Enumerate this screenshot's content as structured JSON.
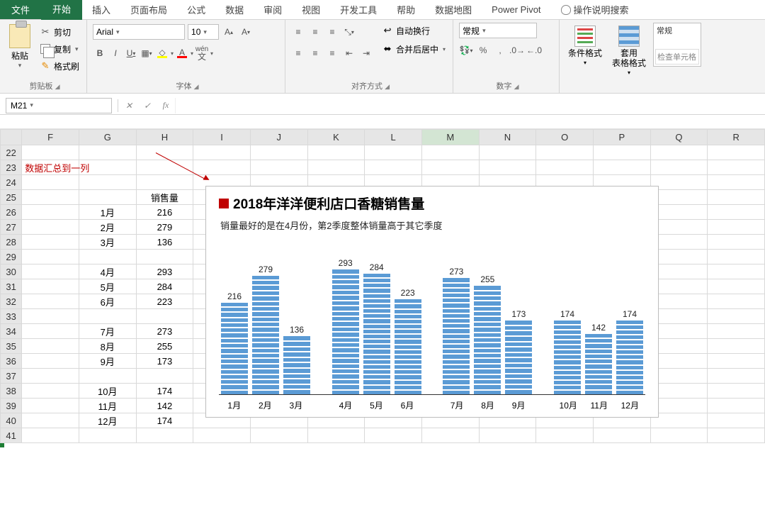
{
  "tabs": {
    "file": "文件",
    "start": "开始",
    "insert": "插入",
    "page": "页面布局",
    "formula": "公式",
    "data": "数据",
    "review": "审阅",
    "view": "视图",
    "dev": "开发工具",
    "help": "帮助",
    "map": "数据地图",
    "pivot": "Power Pivot",
    "tell": "操作说明搜索"
  },
  "ribbon": {
    "clipboard": {
      "paste": "粘贴",
      "cut": "剪切",
      "copy": "复制",
      "painter": "格式刷",
      "title": "剪贴板"
    },
    "font": {
      "name": "Arial",
      "size": "10",
      "title": "字体",
      "wen": "wén"
    },
    "align": {
      "wrap": "自动换行",
      "merge": "合并后居中",
      "title": "对齐方式"
    },
    "number": {
      "format": "常规",
      "title": "数字"
    },
    "styles": {
      "cond": "条件格式",
      "table": "套用\n表格格式"
    },
    "cell_styles": {
      "label": "常规",
      "check": "检查单元格"
    }
  },
  "namebox": "M21",
  "columns": [
    "F",
    "G",
    "H",
    "I",
    "J",
    "K",
    "L",
    "M",
    "N",
    "O",
    "P",
    "Q",
    "R"
  ],
  "active_col": "M",
  "row_start": 22,
  "row_end": 41,
  "annotation": "数据汇总到一列",
  "table": {
    "header_label": "销售量",
    "rows": [
      {
        "r": 25,
        "g": "",
        "h": "销售量"
      },
      {
        "r": 26,
        "g": "1月",
        "h": "216"
      },
      {
        "r": 27,
        "g": "2月",
        "h": "279"
      },
      {
        "r": 28,
        "g": "3月",
        "h": "136"
      },
      {
        "r": 29,
        "g": "",
        "h": ""
      },
      {
        "r": 30,
        "g": "4月",
        "h": "293"
      },
      {
        "r": 31,
        "g": "5月",
        "h": "284"
      },
      {
        "r": 32,
        "g": "6月",
        "h": "223"
      },
      {
        "r": 33,
        "g": "",
        "h": ""
      },
      {
        "r": 34,
        "g": "7月",
        "h": "273"
      },
      {
        "r": 35,
        "g": "8月",
        "h": "255"
      },
      {
        "r": 36,
        "g": "9月",
        "h": "173"
      },
      {
        "r": 37,
        "g": "",
        "h": ""
      },
      {
        "r": 38,
        "g": "10月",
        "h": "174"
      },
      {
        "r": 39,
        "g": "11月",
        "h": "142"
      },
      {
        "r": 40,
        "g": "12月",
        "h": "174"
      }
    ]
  },
  "chart_data": {
    "type": "bar",
    "title": "2018年洋洋便利店口香糖销售量",
    "subtitle": "销量最好的是在4月份，第2季度整体销量高于其它季度",
    "ylim": [
      0,
      300
    ],
    "series": [
      {
        "name": "销售量",
        "categories": [
          "1月",
          "2月",
          "3月",
          "4月",
          "5月",
          "6月",
          "7月",
          "8月",
          "9月",
          "10月",
          "11月",
          "12月"
        ],
        "values": [
          216,
          279,
          136,
          293,
          284,
          223,
          273,
          255,
          173,
          174,
          142,
          174
        ],
        "group_breaks": [
          3,
          6,
          9
        ]
      }
    ]
  }
}
